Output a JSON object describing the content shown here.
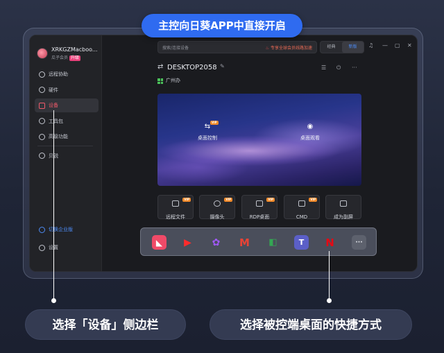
{
  "banner": {
    "title": "主控向日葵APP中直接开启"
  },
  "sidebar": {
    "user_name": "XRKGZMacboo...",
    "member_label": "瓜子会员",
    "upgrade_label": "升级",
    "items": [
      {
        "label": "远程协助",
        "icon": "remote-assist-icon"
      },
      {
        "label": "硬件",
        "icon": "hardware-icon"
      },
      {
        "label": "设备",
        "icon": "monitor-icon",
        "active": true
      },
      {
        "label": "工具包",
        "icon": "toolkit-icon"
      },
      {
        "label": "高级功能",
        "icon": "advanced-icon"
      },
      {
        "label": "贝锐",
        "icon": "oray-icon"
      }
    ],
    "enterprise_label": "切换企业版",
    "settings_label": "设置"
  },
  "toolbar": {
    "search_placeholder": "搜索/连接设备",
    "promo_text": "专享全球会员线路加速",
    "mode_classic": "经典",
    "mode_new": "新版"
  },
  "device": {
    "name": "DESKTOP2058",
    "location": "广州办"
  },
  "preview": {
    "desktop_control": "桌面控制",
    "desktop_view": "桌面观看",
    "vip": "VIP"
  },
  "actions": [
    {
      "label": "远程文件",
      "vip": true
    },
    {
      "label": "摄像头",
      "vip": true
    },
    {
      "label": "RDP桌面",
      "vip": true
    },
    {
      "label": "CMD",
      "vip": true
    },
    {
      "label": "成为副屏",
      "vip": false
    }
  ],
  "dock": {
    "apps": [
      "sunlogin-app-icon",
      "youtube-app-icon",
      "figma-app-icon",
      "gmail-app-icon",
      "meet-app-icon",
      "teams-app-icon",
      "netflix-app-icon"
    ],
    "more": "···"
  },
  "captions": {
    "left": "选择「设备」侧边栏",
    "right": "选择被控端桌面的快捷方式"
  },
  "colors": {
    "accent": "#2f6bf0",
    "active": "#f05a6a",
    "vip": "#f28a2a"
  }
}
